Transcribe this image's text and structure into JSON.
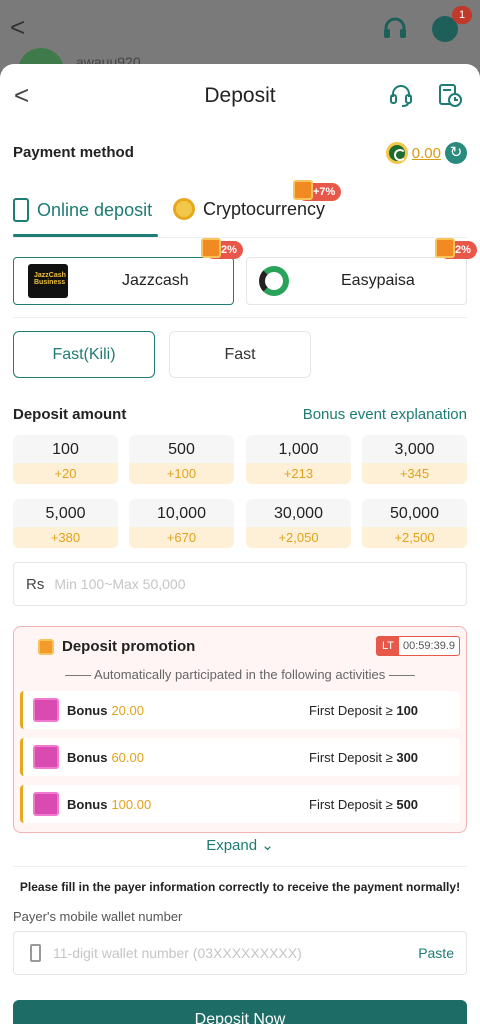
{
  "background": {
    "back_glyph": "<",
    "username": "awauu920",
    "notification_count": "1"
  },
  "header": {
    "back_glyph": "<",
    "title": "Deposit"
  },
  "payment": {
    "label": "Payment method",
    "balance": "0.00"
  },
  "tabs": {
    "online": "Online deposit",
    "crypto": "Cryptocurrency",
    "crypto_bonus": "+7%"
  },
  "methods": [
    {
      "name": "Jazzcash",
      "bonus": "2%",
      "logo_text": "JazzCash Business"
    },
    {
      "name": "Easypaisa",
      "bonus": "2%"
    }
  ],
  "channels": [
    "Fast(Kili)",
    "Fast"
  ],
  "amount": {
    "title": "Deposit amount",
    "bonus_link": "Bonus event explanation",
    "options": [
      {
        "value": "100",
        "bonus": "+20"
      },
      {
        "value": "500",
        "bonus": "+100"
      },
      {
        "value": "1,000",
        "bonus": "+213"
      },
      {
        "value": "3,000",
        "bonus": "+345"
      },
      {
        "value": "5,000",
        "bonus": "+380"
      },
      {
        "value": "10,000",
        "bonus": "+670"
      },
      {
        "value": "30,000",
        "bonus": "+2,050"
      },
      {
        "value": "50,000",
        "bonus": "+2,500"
      }
    ],
    "currency": "Rs",
    "placeholder": "Min 100~Max 50,000"
  },
  "promotion": {
    "title": "Deposit promotion",
    "timer_label": "LT",
    "timer": "00:59:39.9",
    "subtitle": "—— Automatically participated in the following activities ——",
    "rows": [
      {
        "label": "Bonus",
        "amount": "20.00",
        "condition": "First Deposit ≥",
        "threshold": "100"
      },
      {
        "label": "Bonus",
        "amount": "60.00",
        "condition": "First Deposit ≥",
        "threshold": "300"
      },
      {
        "label": "Bonus",
        "amount": "100.00",
        "condition": "First Deposit ≥",
        "threshold": "500"
      }
    ],
    "expand": "Expand"
  },
  "payer": {
    "notice": "Please fill in the payer information correctly to receive the payment normally!",
    "label": "Payer's mobile wallet number",
    "placeholder": "11-digit wallet number (03XXXXXXXXX)",
    "paste": "Paste"
  },
  "submit": "Deposit Now",
  "colors": {
    "accent": "#1d7c73",
    "bonus": "#e2a21b",
    "tag": "#e8584a"
  }
}
